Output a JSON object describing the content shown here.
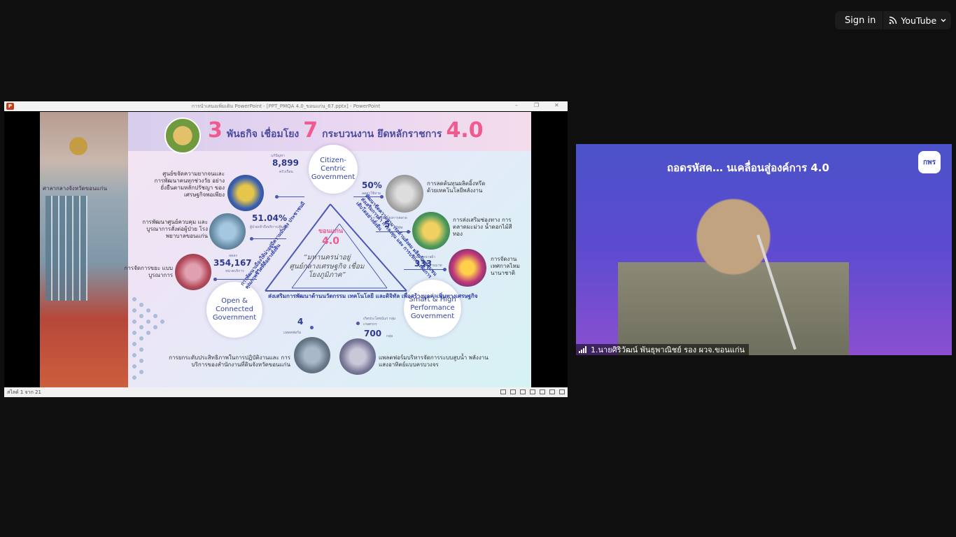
{
  "youtube": {
    "sign_in": "Sign in",
    "app_label": "YouTube"
  },
  "ppt": {
    "title": "การนำเสนอเพิ่มเติม PowerPoint - [PPT_PMQA 4.0_ขอนแก่น_67.pptx] - PowerPoint",
    "status": "สไลด์ 1 จาก 21",
    "icon_letter": "P"
  },
  "slide": {
    "building_sign": "ศาลากลางจังหวัดขอนแก่น",
    "headline": {
      "n1": "3",
      "t1": "พันธกิจ เชื่อมโยง",
      "n2": "7",
      "t2": "กระบวนงาน ยึดหลักราชการ",
      "n3": "4.0"
    },
    "circles": {
      "citizen": "Citizen-Centric Government",
      "open": "Open & Connected Government",
      "smart": "Smart & High Performance Government"
    },
    "center": {
      "label": "ขอนแก่น",
      "value": "4.0",
      "motto": "“มหานครน่าอยู่ ศูนย์กลางเศรษฐกิจ เชื่อมโยงภูมิภาค”"
    },
    "left_side_text": "การพัฒนาเมืองให้น่าอยู่มีความมั่นคง ประชาชนมีคุณภาพชีวิตที่ดีอย่างยั่งยืน",
    "right_side_text": "พัฒนาขีดความสามารถด้านสังคม ผลิตภัณฑ์ชุมชน ส่งเสริมการค้า การลงทุน และ การบริการ เพื่อการเติบโตอย่างยั่งยืน",
    "bottom_text": "ส่งเสริมการพัฒนาด้านนวัตกรรม เทคโนโลยี และดิจิทัล เพื่อสร้างมูลค่าเพิ่มทางเศรษฐกิจ",
    "stats": {
      "s1": {
        "num": "8,899",
        "top": "แก้ปัญหา",
        "bottom": "ครัวเรือน",
        "text": "ศูนย์ขจัดความยากจนและ การพัฒนาคนทุกช่วงวัย อย่างยั่งยืนตามหลักปรัชญา ของเศรษฐกิจพอเพียง"
      },
      "s2": {
        "num": "51.04%",
        "bottom": "ผู้ป่วยเข้าถึงบริการเพิ่มขึ้น",
        "text": "การพัฒนาศูนย์ควบคุม และบูรณาการสั่งต่อผู้ป่วย โรงพยาบาลขอนแก่น"
      },
      "s3": {
        "num": "354,167",
        "top": "ลดลง",
        "bottom": "หน่วยบริการ",
        "text": "การจัดการขยะ แบบบูรณาการ"
      },
      "s4": {
        "num": "50%",
        "bottom": "ลดค่าใช้จ่าย",
        "text": "การลดต้นทุนผลิตอิ้งหรีด ด้วยเทคโนโลยีพลังงาน"
      },
      "s5": {
        "num": "5",
        "top": "การเชื่อมโยงการตลาด",
        "bottom": "บริษัท",
        "text": "การส่งเสริมช่องทาง การตลาดมะม่วง น้ำดอกไม้สีทอง"
      },
      "s6": {
        "num": "333",
        "top": "ยอดจำหน่ายผ้า",
        "bottom": "ล้านบาท",
        "text": "การจัดงาน เทศกาลไหม นานาชาติ"
      },
      "s7": {
        "num": "4",
        "bottom": "แพลตฟอร์ม",
        "text": "การยกระดับประสิทธิภาพในการปฏิบัติงานและ การบริการของสำนักงานที่ดินจังหวัดขอนแก่น"
      },
      "s8": {
        "num": "700",
        "top": "เกิดประโยชน์แก่ กลุ่มเกษตรกร",
        "bottom": "กลุ่ม",
        "text": "แพลตฟอร์มบริหารจัดการระบบสูบน้ำ พลังงานแสงอาทิตย์แบบครบวงจร"
      }
    }
  },
  "video": {
    "header": "ถอดรหัสค…                    นเคลื่อนสู่องค์การ 4.0",
    "logo": "กพร",
    "caption": "1.นายศิริวัฒน์  พันธุพาณิชย์ รอง ผวจ.ขอนแก่น"
  }
}
